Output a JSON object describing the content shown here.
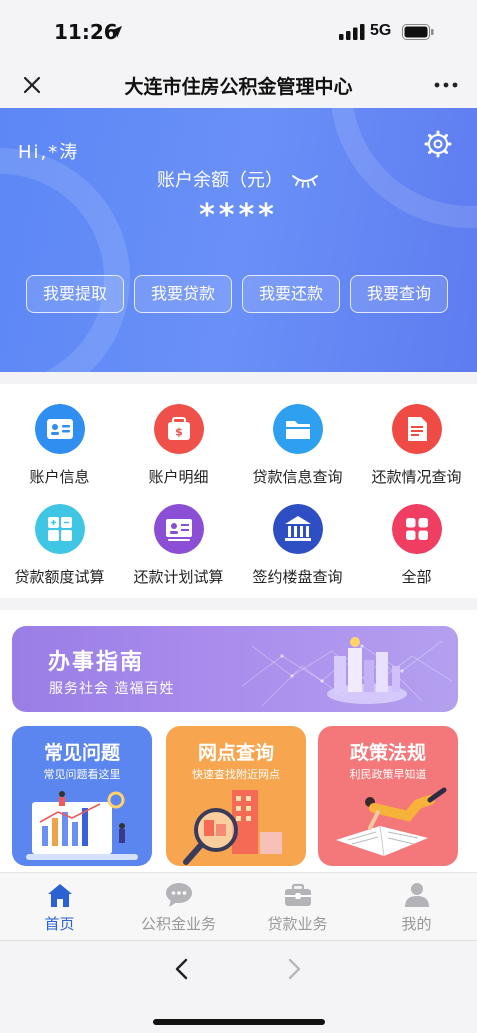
{
  "status_bar": {
    "time": "11:26",
    "network": "5G",
    "icons": [
      "location-arrow-icon",
      "signal-bars-icon",
      "battery-icon"
    ]
  },
  "nav": {
    "title": "大连市住房公积金管理中心",
    "close_icon": "close-icon",
    "more_icon": "more-dots-icon"
  },
  "hero": {
    "greeting": "Hi,*涛",
    "balance_label": "账户余额（元）",
    "balance_value": "****",
    "settings_icon": "gear-icon",
    "eye_icon": "eye-closed-icon",
    "background_color": "#6a90f7",
    "actions": [
      {
        "label": "我要提取"
      },
      {
        "label": "我要贷款"
      },
      {
        "label": "我要还款"
      },
      {
        "label": "我要查询"
      }
    ]
  },
  "services": [
    {
      "label": "账户信息",
      "icon": "id-card-icon",
      "color": "#2f8ef0"
    },
    {
      "label": "账户明细",
      "icon": "wallet-icon",
      "color": "#f0504a"
    },
    {
      "label": "贷款信息查询",
      "icon": "folder-icon",
      "color": "#2f9ff0"
    },
    {
      "label": "还款情况查询",
      "icon": "document-icon",
      "color": "#f04a44"
    },
    {
      "label": "贷款额度试算",
      "icon": "calculator-icon",
      "color": "#3ec6e4"
    },
    {
      "label": "还款计划试算",
      "icon": "presentation-icon",
      "color": "#8a4fd4"
    },
    {
      "label": "签约楼盘查询",
      "icon": "bank-building-icon",
      "color": "#2e4fc4"
    },
    {
      "label": "全部",
      "icon": "grid-apps-icon",
      "color": "#f03e63"
    }
  ],
  "guide_banner": {
    "title": "办事指南",
    "subtitle": "服务社会 造福百姓"
  },
  "cards": [
    {
      "title": "常见问题",
      "subtitle": "常见问题看这里",
      "color": "#5b86ef"
    },
    {
      "title": "网点查询",
      "subtitle": "快速查找附近网点",
      "color": "#f7a64f"
    },
    {
      "title": "政策法规",
      "subtitle": "利民政策早知道",
      "color": "#f4787a"
    }
  ],
  "tabs": [
    {
      "label": "首页",
      "icon": "home-icon",
      "active": true
    },
    {
      "label": "公积金业务",
      "icon": "chat-bubble-icon",
      "active": false
    },
    {
      "label": "贷款业务",
      "icon": "briefcase-icon",
      "active": false
    },
    {
      "label": "我的",
      "icon": "user-icon",
      "active": false
    }
  ],
  "accent_color": "#2a62d4",
  "browser": {
    "back_icon": "chevron-left-icon",
    "forward_icon": "chevron-right-icon"
  }
}
